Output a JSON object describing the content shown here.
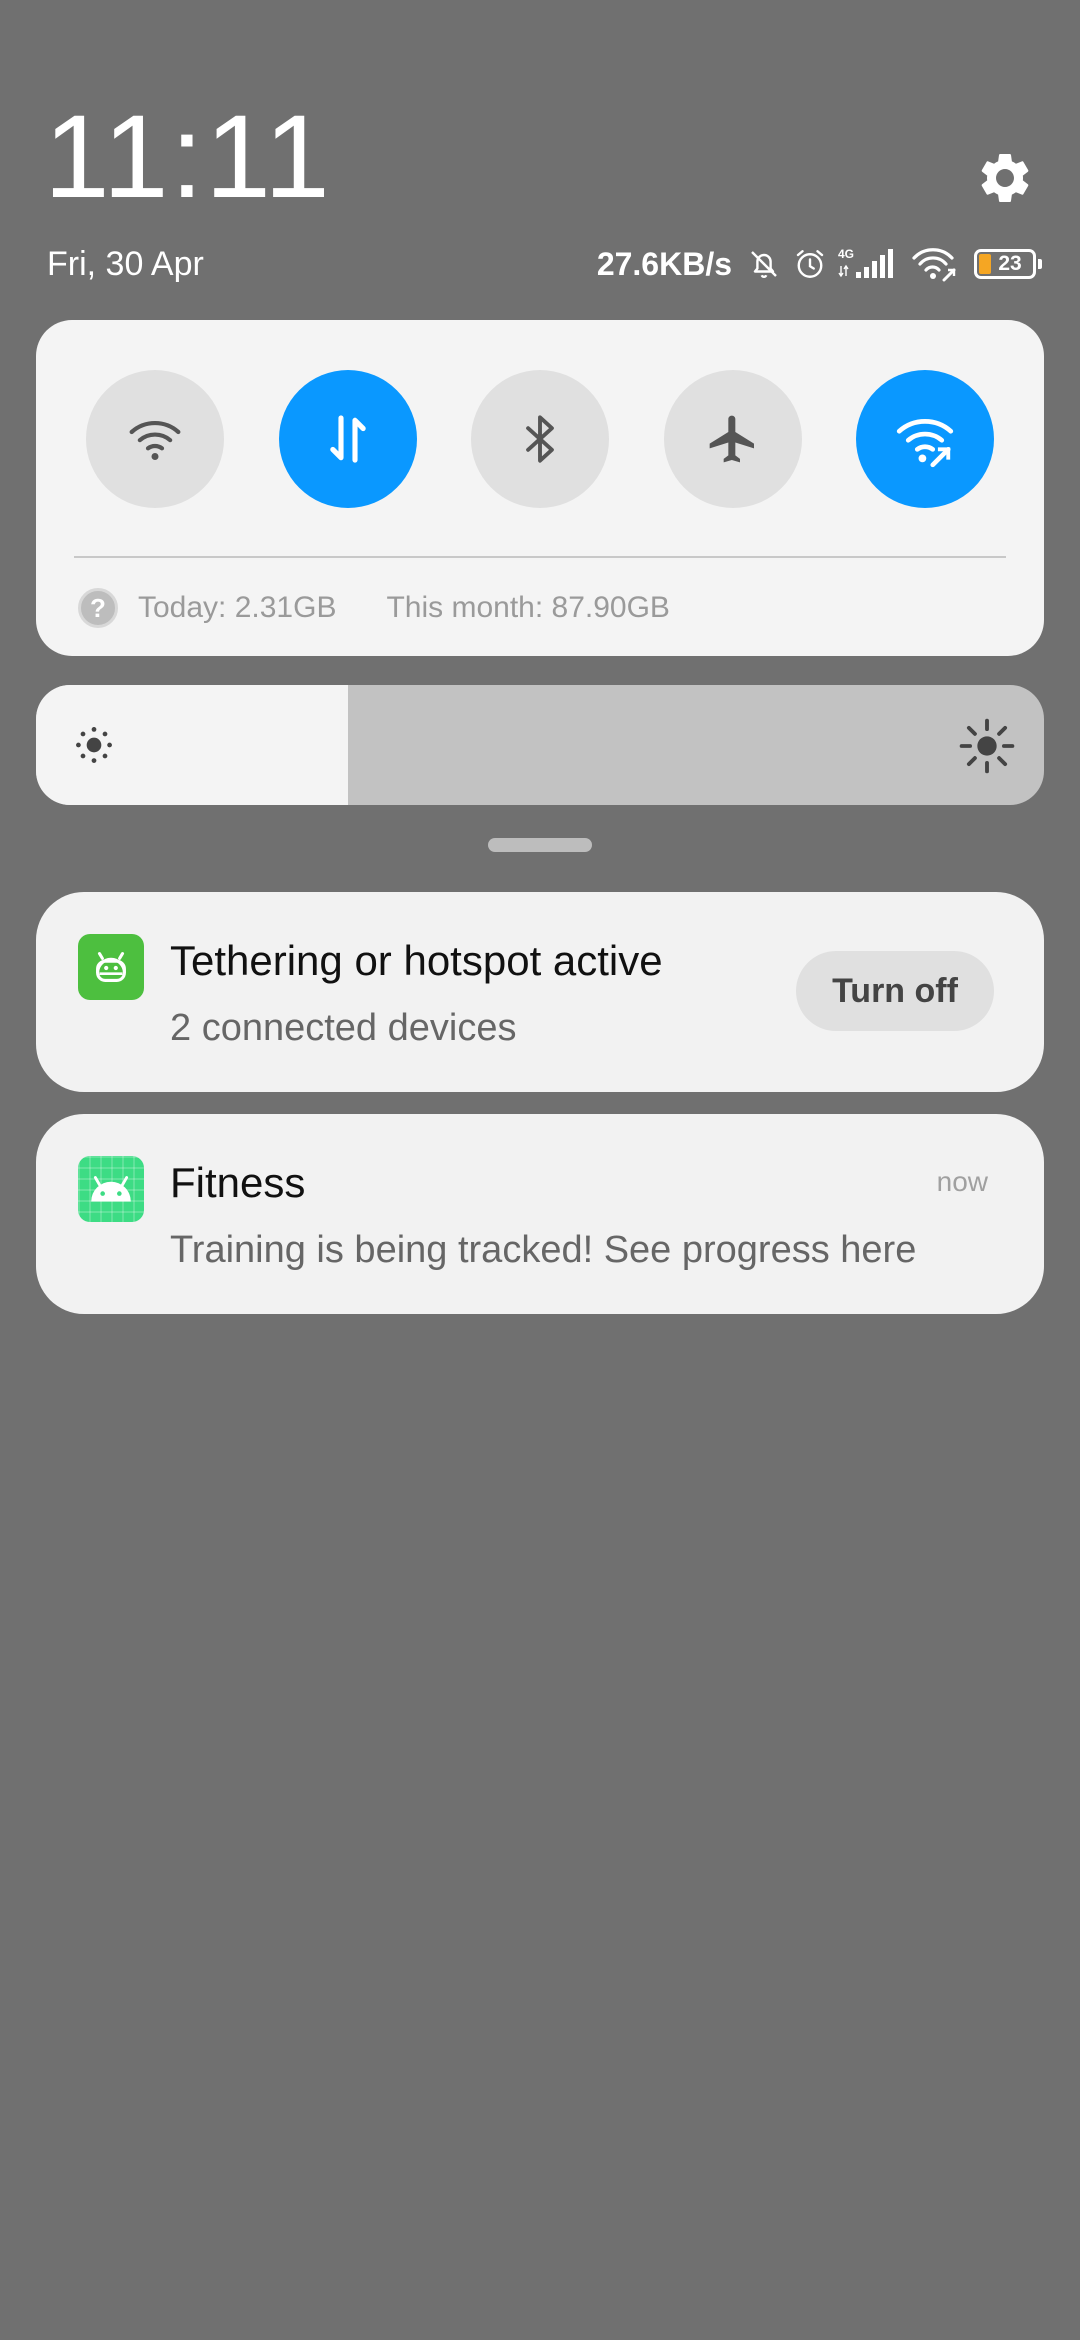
{
  "header": {
    "time": "11:11",
    "date": "Fri, 30 Apr",
    "settings_icon": "gear-icon"
  },
  "status_bar": {
    "net_speed": "27.6KB/s",
    "network_type": "4G",
    "battery_level": "23",
    "icons": [
      "bell-off-icon",
      "alarm-icon",
      "signal-icon",
      "wifi-icon",
      "battery-icon"
    ],
    "battery_color": "#f5a623"
  },
  "quick_settings": {
    "accent_color": "#0a98ff",
    "toggles": [
      {
        "id": "wifi",
        "icon": "wifi-icon",
        "active": false
      },
      {
        "id": "mobile-data",
        "icon": "data-arrows-icon",
        "active": true
      },
      {
        "id": "bluetooth",
        "icon": "bluetooth-icon",
        "active": false
      },
      {
        "id": "airplane",
        "icon": "airplane-icon",
        "active": false
      },
      {
        "id": "hotspot",
        "icon": "hotspot-icon",
        "active": true
      }
    ],
    "usage_today": "Today: 2.31GB",
    "usage_month": "This month: 87.90GB"
  },
  "brightness": {
    "level": 0.31
  },
  "notifications": [
    {
      "icon": "hotspot-android-icon",
      "title": "Tethering or hotspot active",
      "text": "2 connected devices",
      "action_label": "Turn off"
    },
    {
      "icon": "android-icon",
      "title": "Fitness",
      "text": "Training is being tracked! See progress here",
      "time": "now"
    }
  ]
}
